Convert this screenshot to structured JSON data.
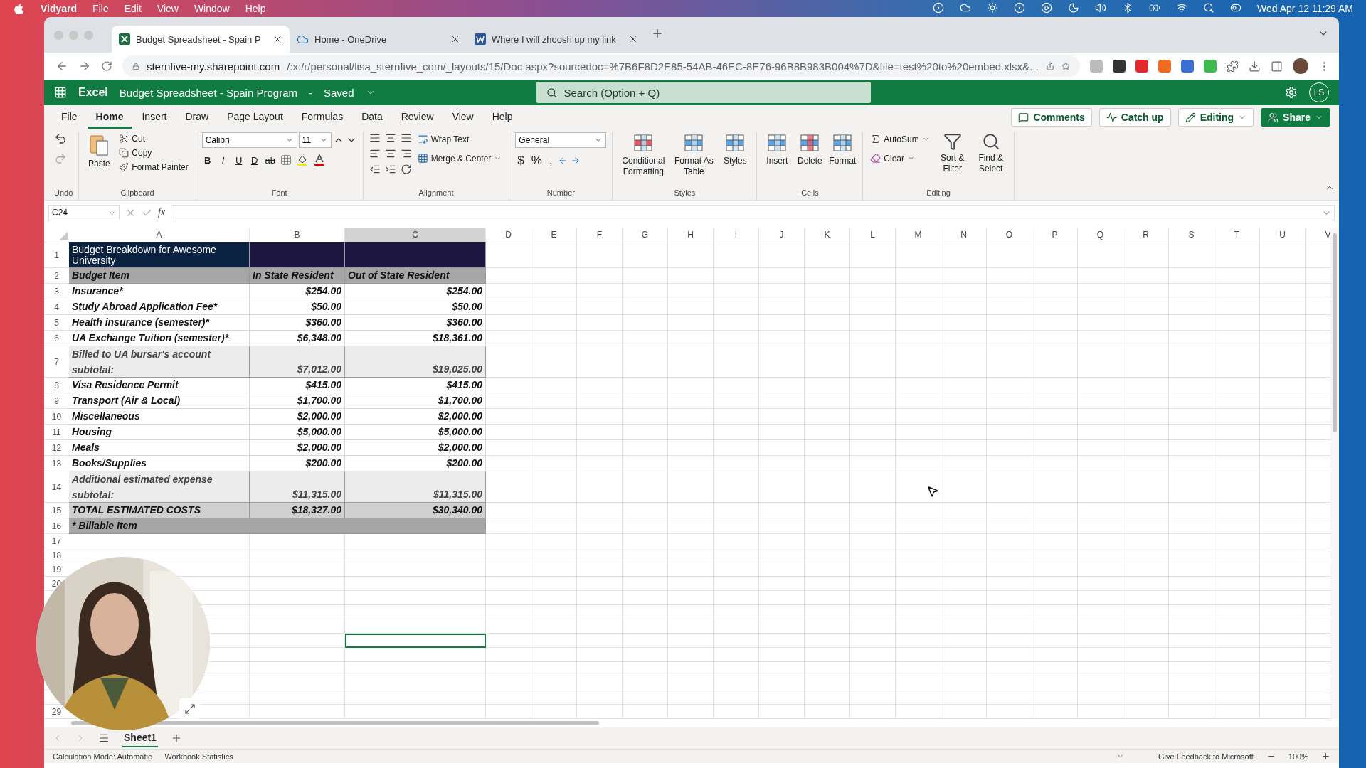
{
  "menubar": {
    "app": "Vidyard",
    "menus": [
      "File",
      "Edit",
      "View",
      "Window",
      "Help"
    ],
    "clock": "Wed Apr 12  11:29 AM"
  },
  "browser": {
    "tabs": [
      {
        "title": "Budget Spreadsheet - Spain P",
        "kind": "excel",
        "selected": true
      },
      {
        "title": "Home - OneDrive",
        "kind": "onedrive",
        "selected": false
      },
      {
        "title": "Where I will zhoosh up my link",
        "kind": "word",
        "selected": false
      }
    ],
    "url_host": "sternfive-my.sharepoint.com",
    "url_path": "/:x:/r/personal/lisa_sternfive_com/_layouts/15/Doc.aspx?sourcedoc=%7B6F8D2E85-54AB-46EC-8E76-96B8B983B004%7D&file=test%20to%20embed.xlsx&..."
  },
  "excel": {
    "app": "Excel",
    "doc_title": "Budget Spreadsheet - Spain Program",
    "separator": "-",
    "save_state": "Saved",
    "search_placeholder": "Search (Option + Q)",
    "avatar": "LS"
  },
  "ribbon_tabs": [
    {
      "label": "File",
      "selected": false
    },
    {
      "label": "Home",
      "selected": true
    },
    {
      "label": "Insert",
      "selected": false
    },
    {
      "label": "Draw",
      "selected": false
    },
    {
      "label": "Page Layout",
      "selected": false
    },
    {
      "label": "Formulas",
      "selected": false
    },
    {
      "label": "Data",
      "selected": false
    },
    {
      "label": "Review",
      "selected": false
    },
    {
      "label": "View",
      "selected": false
    },
    {
      "label": "Help",
      "selected": false
    }
  ],
  "ribbon_actions": [
    {
      "label": "Comments",
      "kind": "comments"
    },
    {
      "label": "Catch up",
      "kind": "catchup"
    },
    {
      "label": "Editing",
      "kind": "editing"
    },
    {
      "label": "Share",
      "kind": "share"
    }
  ],
  "ribbon_groups": [
    {
      "kind": "undo",
      "label": "Undo"
    },
    {
      "kind": "clipboard",
      "label": "Clipboard",
      "paste": "Paste",
      "items": [
        "Cut",
        "Copy",
        "Format Painter"
      ]
    },
    {
      "kind": "font",
      "label": "Font",
      "font": "Calibri",
      "size": "11",
      "styles": [
        "B",
        "I",
        "U",
        "D",
        "ab"
      ]
    },
    {
      "kind": "alignment",
      "label": "Alignment",
      "wrap": "Wrap Text",
      "merge": "Merge & Center"
    },
    {
      "kind": "number",
      "label": "Number",
      "format": "General",
      "symbols": [
        "$",
        "%",
        ","
      ]
    },
    {
      "kind": "styles",
      "label": "Styles",
      "items": [
        "Conditional Formatting",
        "Format As Table",
        "Styles"
      ]
    },
    {
      "kind": "cells",
      "label": "Cells",
      "items": [
        "Insert",
        "Delete",
        "Format"
      ]
    },
    {
      "kind": "editing",
      "label": "Editing",
      "autosum": "AutoSum",
      "clear": "Clear",
      "items": [
        "Sort & Filter",
        "Find & Select"
      ]
    }
  ],
  "formula_bar": {
    "name_box": "C24",
    "fx": "fx"
  },
  "columns": [
    {
      "label": "A",
      "selected": false
    },
    {
      "label": "B",
      "selected": false
    },
    {
      "label": "C",
      "selected": true
    },
    {
      "label": "D",
      "selected": false
    },
    {
      "label": "E",
      "selected": false
    },
    {
      "label": "F",
      "selected": false
    },
    {
      "label": "G",
      "selected": false
    },
    {
      "label": "H",
      "selected": false
    },
    {
      "label": "I",
      "selected": false
    },
    {
      "label": "J",
      "selected": false
    },
    {
      "label": "K",
      "selected": false
    },
    {
      "label": "L",
      "selected": false
    },
    {
      "label": "M",
      "selected": false
    },
    {
      "label": "N",
      "selected": false
    },
    {
      "label": "O",
      "selected": false
    },
    {
      "label": "P",
      "selected": false
    },
    {
      "label": "Q",
      "selected": false
    },
    {
      "label": "R",
      "selected": false
    },
    {
      "label": "S",
      "selected": false
    },
    {
      "label": "T",
      "selected": false
    },
    {
      "label": "U",
      "selected": false
    },
    {
      "label": "V",
      "selected": false
    }
  ],
  "rows": [
    {
      "label": "1",
      "kind": "title",
      "cells": [
        "Budget Breakdown for Awesome University"
      ]
    },
    {
      "label": "2",
      "kind": "header",
      "cells": [
        "Budget Item",
        "In State Resident",
        "Out of State Resident"
      ]
    },
    {
      "label": "3",
      "kind": "item",
      "cells": [
        "Insurance*",
        "$254.00",
        "$254.00"
      ]
    },
    {
      "label": "4",
      "kind": "item",
      "cells": [
        "Study Abroad Application Fee*",
        "$50.00",
        "$50.00"
      ]
    },
    {
      "label": "5",
      "kind": "item",
      "cells": [
        "Health insurance (semester)*",
        "$360.00",
        "$360.00"
      ]
    },
    {
      "label": "6",
      "kind": "item",
      "cells": [
        "UA Exchange Tuition (semester)*",
        "$6,348.00",
        "$18,361.00"
      ]
    },
    {
      "label": "7",
      "kind": "subtotal",
      "cells": [
        "Billed to UA bursar's account subtotal:",
        "$7,012.00",
        "$19,025.00"
      ]
    },
    {
      "label": "8",
      "kind": "item",
      "cells": [
        "Visa Residence Permit",
        "$415.00",
        "$415.00"
      ]
    },
    {
      "label": "9",
      "kind": "item",
      "cells": [
        "Transport (Air & Local)",
        "$1,700.00",
        "$1,700.00"
      ]
    },
    {
      "label": "10",
      "kind": "item",
      "cells": [
        "Miscellaneous",
        "$2,000.00",
        "$2,000.00"
      ]
    },
    {
      "label": "11",
      "kind": "item",
      "cells": [
        "Housing",
        "$5,000.00",
        "$5,000.00"
      ]
    },
    {
      "label": "12",
      "kind": "item",
      "cells": [
        "Meals",
        "$2,000.00",
        "$2,000.00"
      ]
    },
    {
      "label": "13",
      "kind": "item",
      "cells": [
        "Books/Supplies",
        "$200.00",
        "$200.00"
      ]
    },
    {
      "label": "14",
      "kind": "subtotal",
      "cells": [
        "Additional estimated expense subtotal:",
        "$11,315.00",
        "$11,315.00"
      ]
    },
    {
      "label": "15",
      "kind": "total",
      "cells": [
        "TOTAL ESTIMATED COSTS",
        "$18,327.00",
        "$30,340.00"
      ]
    },
    {
      "label": "16",
      "kind": "note",
      "cells": [
        "* Billable Item"
      ]
    }
  ],
  "blank_rows": [
    {
      "label": "17",
      "selected": false
    },
    {
      "label": "18",
      "selected": false
    },
    {
      "label": "19",
      "selected": false
    },
    {
      "label": "20",
      "selected": false
    },
    {
      "selected": false
    },
    {
      "selected": false
    },
    {
      "selected": false
    },
    {
      "selected": true
    },
    {
      "selected": false
    },
    {
      "selected": false
    },
    {
      "selected": false
    },
    {
      "selected": false
    },
    {
      "label": "29",
      "selected": false
    }
  ],
  "sheet_tabs": [
    {
      "label": "Sheet1",
      "selected": true
    }
  ],
  "status_bar": {
    "left": [
      "Calculation Mode: Automatic",
      "Workbook Statistics"
    ],
    "feedback": "Give Feedback to Microsoft",
    "zoom": "100%"
  }
}
